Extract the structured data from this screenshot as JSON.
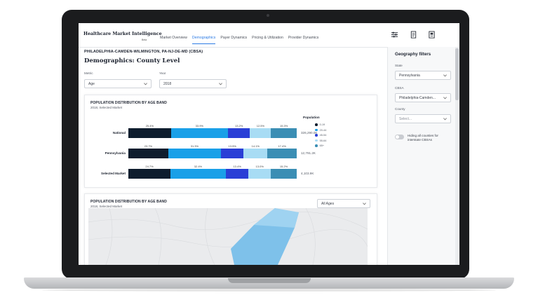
{
  "app": {
    "brand": "Healthcare Market Intelligence",
    "brand_sub": "Beta",
    "nav_tabs": [
      {
        "label": "Market Overview",
        "active": false
      },
      {
        "label": "Demographics",
        "active": true
      },
      {
        "label": "Payer Dynamics",
        "active": false
      },
      {
        "label": "Pricing & Utilization",
        "active": false
      },
      {
        "label": "Provider Dynamics",
        "active": false
      }
    ],
    "header_icons": [
      "filters-icon",
      "document-icon",
      "report-icon"
    ]
  },
  "main": {
    "cbsa_title": "PHILADELPHIA-CAMDEN-WILMINGTON, PA-NJ-DE-MD (CBSA)",
    "page_title": "Demographics: County Level",
    "metric": {
      "label": "Metric",
      "value": "Age"
    },
    "year": {
      "label": "Year",
      "value": "2018"
    }
  },
  "age_chart": {
    "title": "POPULATION DISTRIBUTION BY AGE BAND",
    "subtitle": "2018, Selected Market",
    "legend_title": "Population",
    "legend": [
      "0-19",
      "20-44",
      "45-54",
      "55-64",
      "65+"
    ],
    "colors": [
      "#0e1d2e",
      "#1aa0e8",
      "#2a3fd6",
      "#a8dcf4",
      "#3b8eb4"
    ]
  },
  "chart_data": {
    "type": "bar",
    "stacked": true,
    "orientation": "horizontal",
    "title": "POPULATION DISTRIBUTION BY AGE BAND",
    "subtitle": "2018, Selected Market",
    "categories": [
      "National",
      "Pennsylvania",
      "Selected Market"
    ],
    "series": [
      {
        "name": "0-19",
        "values": [
          25.4,
          23.7,
          24.7
        ]
      },
      {
        "name": "20-44",
        "values": [
          33.9,
          31.3,
          32.4
        ]
      },
      {
        "name": "45-54",
        "values": [
          13.2,
          13.5,
          13.4
        ]
      },
      {
        "name": "55-64",
        "values": [
          12.5,
          14.1,
          13.0
        ]
      },
      {
        "name": "65+",
        "values": [
          15.3,
          17.4,
          15.2
        ]
      }
    ],
    "value_labels": [
      [
        "25.4%",
        "33.9%",
        "13.2%",
        "12.5%",
        "15.3%"
      ],
      [
        "23.7%",
        "31.3%",
        "13.5%",
        "14.1%",
        "17.4%"
      ],
      [
        "24.7%",
        "32.4%",
        "13.4%",
        "13.0%",
        "15.2%"
      ]
    ],
    "totals": [
      "326,290.0K",
      "12,791.2K",
      "4,103.9K"
    ],
    "legend_title": "Population",
    "legend_position": "right"
  },
  "map_card": {
    "title": "POPULATION DISTRIBUTION BY AGE BAND",
    "subtitle": "2018, Selected Market",
    "dropdown": "All Ages"
  },
  "filters": {
    "title": "Geography filters",
    "state": {
      "label": "State",
      "value": "Pennsylvania"
    },
    "cbsa": {
      "label": "CBSA",
      "value": "Philadelphia-Camden..."
    },
    "county": {
      "label": "County",
      "placeholder": "Select..."
    },
    "toggle_label": "Hiding all counties for interstate CBSAs",
    "toggle_on": false
  }
}
